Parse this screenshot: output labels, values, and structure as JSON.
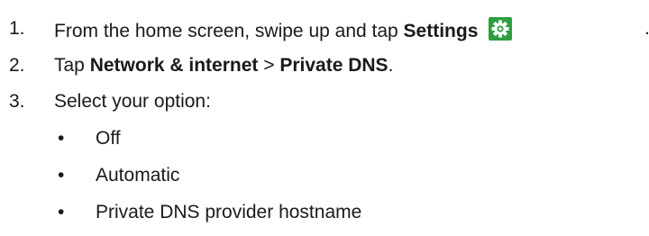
{
  "steps": [
    {
      "number": "1.",
      "prefix": "From the home screen, swipe up and tap ",
      "bold": "Settings",
      "suffix": "."
    },
    {
      "number": "2.",
      "prefix": "Tap ",
      "bold1": "Network & internet",
      "middle": " > ",
      "bold2": "Private DNS",
      "suffix": "."
    },
    {
      "number": "3.",
      "text": "Select your option:"
    }
  ],
  "options": [
    {
      "bullet": "•",
      "label": "Off"
    },
    {
      "bullet": "•",
      "label": "Automatic"
    },
    {
      "bullet": "•",
      "label": "Private DNS provider hostname"
    }
  ],
  "icons": {
    "settings": "gear-icon",
    "settings_color": "#2e9e41"
  }
}
